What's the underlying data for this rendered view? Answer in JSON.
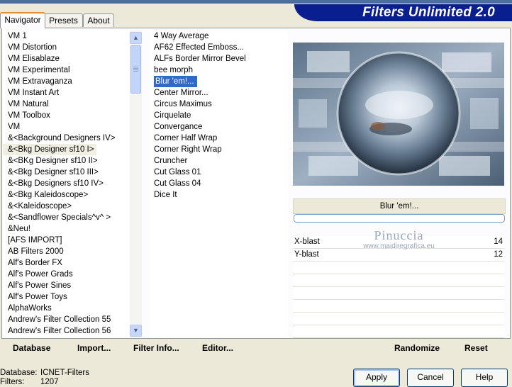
{
  "tabs": [
    {
      "label": "Navigator"
    },
    {
      "label": "Presets"
    },
    {
      "label": "About"
    }
  ],
  "banner_title": "Filters Unlimited 2.0",
  "categories": [
    "VM 1",
    "VM Distortion",
    "VM Elisablaze",
    "VM Experimental",
    "VM Extravaganza",
    "VM Instant Art",
    "VM Natural",
    "VM Toolbox",
    "VM",
    "&<Background Designers IV>",
    "&<Bkg Designer sf10 I>",
    "&<BKg Designer sf10 II>",
    "&<Bkg Designer sf10 III>",
    "&<Bkg Designers sf10 IV>",
    "&<Bkg Kaleidoscope>",
    "&<Kaleidoscope>",
    "&<Sandflower Specials^v^ >",
    "&Neu!",
    "[AFS IMPORT]",
    "AB Filters 2000",
    "Alf's Border FX",
    "Alf's Power Grads",
    "Alf's Power Sines",
    "Alf's Power Toys",
    "AlphaWorks",
    "Andrew's Filter Collection 55",
    "Andrew's Filter Collection 56"
  ],
  "selected_category": "&<Bkg Designer sf10 I>",
  "filters": [
    "4 Way Average",
    "AF62 Effected Emboss...",
    "ALFs Border Mirror Bevel",
    "bee morph",
    "Blur 'em!...",
    "Center Mirror...",
    "Circus Maximus",
    "Cirquelate",
    "Convergance",
    "Corner Half Wrap",
    "Corner Right Wrap",
    "Cruncher",
    "Cut Glass 01",
    "Cut Glass 04",
    "Dice It"
  ],
  "selected_filter": "Blur 'em!...",
  "filter_name_label": "Blur 'em!...",
  "params": [
    {
      "name": "X-blast",
      "value": "14"
    },
    {
      "name": "Y-blast",
      "value": "12"
    }
  ],
  "watermark": {
    "line1": "Pinuccia",
    "line2": "www.maidiregrafica.eu"
  },
  "left_buttons": {
    "database": "Database",
    "import": "Import...",
    "filter_info": "Filter Info...",
    "editor": "Editor..."
  },
  "right_buttons": {
    "randomize": "Randomize",
    "reset": "Reset"
  },
  "status": {
    "database_label": "Database:",
    "database_value": "ICNET-Filters",
    "filters_label": "Filters:",
    "filters_value": "1207"
  },
  "dialog_buttons": {
    "apply": "Apply",
    "cancel": "Cancel",
    "help": "Help"
  },
  "colors": {
    "banner": "#0a1f8f",
    "selection": "#316ac5",
    "dialog_bg": "#ece9d8",
    "active_tab_accent": "#e68b2c"
  }
}
